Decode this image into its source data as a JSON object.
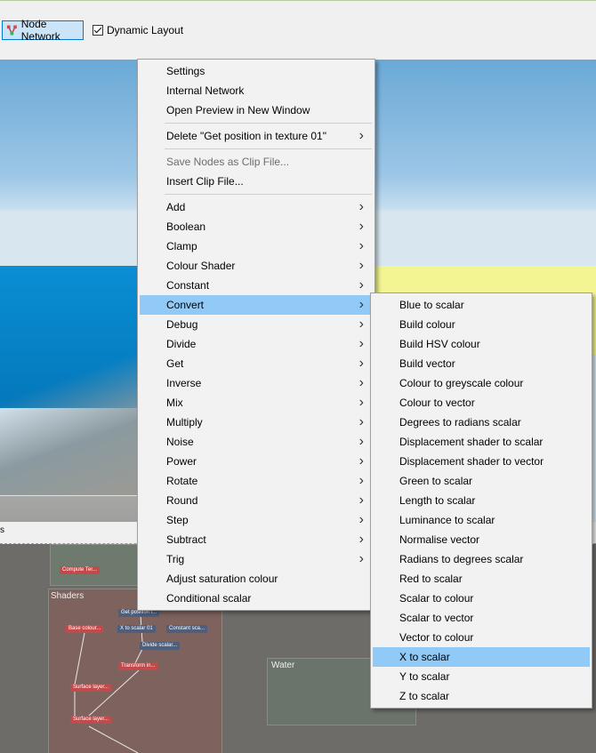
{
  "toolbar": {
    "node_network_label": "Node Network",
    "dynamic_layout_label": "Dynamic Layout",
    "dynamic_layout_checked": true
  },
  "status": {
    "text": "s"
  },
  "graph": {
    "shaders_label": "Shaders",
    "water_label": "Water",
    "nodes": [
      "Compute Ter...",
      "Get position i...",
      "Base colour...",
      "X to scalar 01",
      "Constant sca...",
      "Divide scalar...",
      "Transform in...",
      "Surface layer...",
      "Surface layer..."
    ]
  },
  "context_menu": {
    "items": [
      {
        "label": "Settings"
      },
      {
        "label": "Internal Network"
      },
      {
        "label": "Open Preview in New Window"
      },
      {
        "label": "Delete \"Get position in texture 01\"",
        "submenu": true
      },
      {
        "label": "Save Nodes as Clip File...",
        "disabled": true
      },
      {
        "label": "Insert Clip File..."
      },
      {
        "label": "Add",
        "submenu": true
      },
      {
        "label": "Boolean",
        "submenu": true
      },
      {
        "label": "Clamp",
        "submenu": true
      },
      {
        "label": "Colour Shader",
        "submenu": true
      },
      {
        "label": "Constant",
        "submenu": true
      },
      {
        "label": "Convert",
        "submenu": true,
        "highlighted": true
      },
      {
        "label": "Debug",
        "submenu": true
      },
      {
        "label": "Divide",
        "submenu": true
      },
      {
        "label": "Get",
        "submenu": true
      },
      {
        "label": "Inverse",
        "submenu": true
      },
      {
        "label": "Mix",
        "submenu": true
      },
      {
        "label": "Multiply",
        "submenu": true
      },
      {
        "label": "Noise",
        "submenu": true
      },
      {
        "label": "Power",
        "submenu": true
      },
      {
        "label": "Rotate",
        "submenu": true
      },
      {
        "label": "Round",
        "submenu": true
      },
      {
        "label": "Step",
        "submenu": true
      },
      {
        "label": "Subtract",
        "submenu": true
      },
      {
        "label": "Trig",
        "submenu": true
      },
      {
        "label": "Adjust saturation colour"
      },
      {
        "label": "Conditional scalar"
      }
    ]
  },
  "convert_submenu": {
    "items": [
      {
        "label": "Blue to scalar"
      },
      {
        "label": "Build colour"
      },
      {
        "label": "Build HSV colour"
      },
      {
        "label": "Build vector"
      },
      {
        "label": "Colour to greyscale colour"
      },
      {
        "label": "Colour to vector"
      },
      {
        "label": "Degrees to radians scalar"
      },
      {
        "label": "Displacement shader to scalar"
      },
      {
        "label": "Displacement shader to vector"
      },
      {
        "label": "Green to scalar"
      },
      {
        "label": "Length to scalar"
      },
      {
        "label": "Luminance to scalar"
      },
      {
        "label": "Normalise vector"
      },
      {
        "label": "Radians to degrees scalar"
      },
      {
        "label": "Red to scalar"
      },
      {
        "label": "Scalar to colour"
      },
      {
        "label": "Scalar to vector"
      },
      {
        "label": "Vector to colour"
      },
      {
        "label": "X to scalar",
        "highlighted": true
      },
      {
        "label": "Y to scalar"
      },
      {
        "label": "Z to scalar"
      }
    ]
  },
  "colors": {
    "highlight": "#91c9f7",
    "menu_bg": "#f2f2f2",
    "toolbar_active": "#cce4f7",
    "sky": "#9cc6e6",
    "sea": "#0a8ed4",
    "yellow_panel": "#f3f592",
    "graph_bg": "#6e6c69",
    "node_red": "#c24a4a",
    "node_blue": "#4e5f7d"
  }
}
